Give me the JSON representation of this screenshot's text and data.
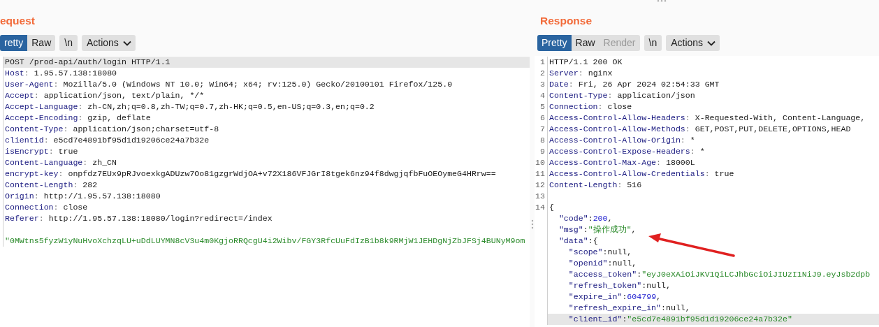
{
  "request": {
    "title": "equest",
    "tabs": [
      {
        "label": "retty",
        "selected": true,
        "disabled": false
      },
      {
        "label": "Raw",
        "selected": false,
        "disabled": false
      }
    ],
    "newline_button": "\\n",
    "actions_button": "Actions",
    "lines": [
      {
        "selected": true,
        "segments": [
          {
            "kind": "value",
            "text": "POST /prod-api/auth/login HTTP/1.1"
          }
        ]
      },
      {
        "selected": false,
        "segments": [
          {
            "kind": "name",
            "text": "Host"
          },
          {
            "kind": "sep",
            "text": ": "
          },
          {
            "kind": "value",
            "text": "1.95.57.138:18080"
          }
        ]
      },
      {
        "selected": false,
        "segments": [
          {
            "kind": "name",
            "text": "User-Agent"
          },
          {
            "kind": "sep",
            "text": ": "
          },
          {
            "kind": "value",
            "text": "Mozilla/5.0 (Windows NT 10.0; Win64; x64; rv:125.0) Gecko/20100101 Firefox/125.0"
          }
        ]
      },
      {
        "selected": false,
        "segments": [
          {
            "kind": "name",
            "text": "Accept"
          },
          {
            "kind": "sep",
            "text": ": "
          },
          {
            "kind": "value",
            "text": "application/json, text/plain, */*"
          }
        ]
      },
      {
        "selected": false,
        "segments": [
          {
            "kind": "name",
            "text": "Accept-Language"
          },
          {
            "kind": "sep",
            "text": ": "
          },
          {
            "kind": "value",
            "text": "zh-CN,zh;q=0.8,zh-TW;q=0.7,zh-HK;q=0.5,en-US;q=0.3,en;q=0.2"
          }
        ]
      },
      {
        "selected": false,
        "segments": [
          {
            "kind": "name",
            "text": "Accept-Encoding"
          },
          {
            "kind": "sep",
            "text": ": "
          },
          {
            "kind": "value",
            "text": "gzip, deflate"
          }
        ]
      },
      {
        "selected": false,
        "segments": [
          {
            "kind": "name",
            "text": "Content-Type"
          },
          {
            "kind": "sep",
            "text": ": "
          },
          {
            "kind": "value",
            "text": "application/json;charset=utf-8"
          }
        ]
      },
      {
        "selected": false,
        "segments": [
          {
            "kind": "name",
            "text": "clientid"
          },
          {
            "kind": "sep",
            "text": ": "
          },
          {
            "kind": "value",
            "text": "e5cd7e4891bf95d1d19206ce24a7b32e"
          }
        ]
      },
      {
        "selected": false,
        "segments": [
          {
            "kind": "name",
            "text": "isEncrypt"
          },
          {
            "kind": "sep",
            "text": ": "
          },
          {
            "kind": "value",
            "text": "true"
          }
        ]
      },
      {
        "selected": false,
        "segments": [
          {
            "kind": "name",
            "text": "Content-Language"
          },
          {
            "kind": "sep",
            "text": ": "
          },
          {
            "kind": "value",
            "text": "zh_CN"
          }
        ]
      },
      {
        "selected": false,
        "segments": [
          {
            "kind": "name",
            "text": "encrypt-key"
          },
          {
            "kind": "sep",
            "text": ": "
          },
          {
            "kind": "value",
            "text": "onpfdz7EUx9pRJvoexkgADUzw7Oo81gzgrWdjOA+v72X186VFJGrI8tgek6nz94f8dwgjqfbFuOEOymeG4HRrw=="
          }
        ]
      },
      {
        "selected": false,
        "segments": [
          {
            "kind": "name",
            "text": "Content-Length"
          },
          {
            "kind": "sep",
            "text": ": "
          },
          {
            "kind": "value",
            "text": "282"
          }
        ]
      },
      {
        "selected": false,
        "segments": [
          {
            "kind": "name",
            "text": "Origin"
          },
          {
            "kind": "sep",
            "text": ": "
          },
          {
            "kind": "value",
            "text": "http://1.95.57.138:18080"
          }
        ]
      },
      {
        "selected": false,
        "segments": [
          {
            "kind": "name",
            "text": "Connection"
          },
          {
            "kind": "sep",
            "text": ": "
          },
          {
            "kind": "value",
            "text": "close"
          }
        ]
      },
      {
        "selected": false,
        "segments": [
          {
            "kind": "name",
            "text": "Referer"
          },
          {
            "kind": "sep",
            "text": ": "
          },
          {
            "kind": "value",
            "text": "http://1.95.57.138:18080/login?redirect=/index"
          }
        ]
      },
      {
        "selected": false
      },
      {
        "selected": false,
        "segments": [
          {
            "kind": "string",
            "text": "\"0MWtns5fyzW1yNuHvoXchzqLU+uDdLUYMN8cV3u4m0KgjoRRQcgU4i2Wibv/FGY3RfcUuFdIzB1b8k9RMjW1JEHDgNjZbJFSj4BUNyM9om"
          }
        ]
      }
    ]
  },
  "response": {
    "title": "Response",
    "tabs": [
      {
        "label": "Pretty",
        "selected": true,
        "disabled": false
      },
      {
        "label": "Raw",
        "selected": false,
        "disabled": false
      },
      {
        "label": "Render",
        "selected": false,
        "disabled": true
      }
    ],
    "newline_button": "\\n",
    "actions_button": "Actions",
    "lines": [
      {
        "number": "1",
        "selected": false,
        "segments": [
          {
            "kind": "value",
            "text": "HTTP/1.1 200 OK"
          }
        ]
      },
      {
        "number": "2",
        "selected": false,
        "segments": [
          {
            "kind": "name",
            "text": "Server"
          },
          {
            "kind": "sep",
            "text": ": "
          },
          {
            "kind": "value",
            "text": "nginx"
          }
        ]
      },
      {
        "number": "3",
        "selected": false,
        "segments": [
          {
            "kind": "name",
            "text": "Date"
          },
          {
            "kind": "sep",
            "text": ": "
          },
          {
            "kind": "value",
            "text": "Fri, 26 Apr 2024 02:54:33 GMT"
          }
        ]
      },
      {
        "number": "4",
        "selected": false,
        "segments": [
          {
            "kind": "name",
            "text": "Content-Type"
          },
          {
            "kind": "sep",
            "text": ": "
          },
          {
            "kind": "value",
            "text": "application/json"
          }
        ]
      },
      {
        "number": "5",
        "selected": false,
        "segments": [
          {
            "kind": "name",
            "text": "Connection"
          },
          {
            "kind": "sep",
            "text": ": "
          },
          {
            "kind": "value",
            "text": "close"
          }
        ]
      },
      {
        "number": "6",
        "selected": false,
        "segments": [
          {
            "kind": "name",
            "text": "Access-Control-Allow-Headers"
          },
          {
            "kind": "sep",
            "text": ": "
          },
          {
            "kind": "value",
            "text": "X-Requested-With, Content-Language,"
          }
        ]
      },
      {
        "number": "7",
        "selected": false,
        "segments": [
          {
            "kind": "name",
            "text": "Access-Control-Allow-Methods"
          },
          {
            "kind": "sep",
            "text": ": "
          },
          {
            "kind": "value",
            "text": "GET,POST,PUT,DELETE,OPTIONS,HEAD"
          }
        ]
      },
      {
        "number": "8",
        "selected": false,
        "segments": [
          {
            "kind": "name",
            "text": "Access-Control-Allow-Origin"
          },
          {
            "kind": "sep",
            "text": ": "
          },
          {
            "kind": "value",
            "text": "*"
          }
        ]
      },
      {
        "number": "9",
        "selected": false,
        "segments": [
          {
            "kind": "name",
            "text": "Access-Control-Expose-Headers"
          },
          {
            "kind": "sep",
            "text": ": "
          },
          {
            "kind": "value",
            "text": "*"
          }
        ]
      },
      {
        "number": "10",
        "selected": false,
        "segments": [
          {
            "kind": "name",
            "text": "Access-Control-Max-Age"
          },
          {
            "kind": "sep",
            "text": ": "
          },
          {
            "kind": "value",
            "text": "18000L"
          }
        ]
      },
      {
        "number": "11",
        "selected": false,
        "segments": [
          {
            "kind": "name",
            "text": "Access-Control-Allow-Credentials"
          },
          {
            "kind": "sep",
            "text": ": "
          },
          {
            "kind": "value",
            "text": "true"
          }
        ]
      },
      {
        "number": "12",
        "selected": false,
        "segments": [
          {
            "kind": "name",
            "text": "Content-Length"
          },
          {
            "kind": "sep",
            "text": ": "
          },
          {
            "kind": "value",
            "text": "516"
          }
        ]
      },
      {
        "number": "13",
        "selected": false
      },
      {
        "number": "14",
        "selected": false,
        "segments": [
          {
            "kind": "punct",
            "text": "{"
          }
        ]
      },
      {
        "selected": false,
        "segments": [
          {
            "kind": "key",
            "text": "  \"code\""
          },
          {
            "kind": "punct",
            "text": ":"
          },
          {
            "kind": "number",
            "text": "200"
          },
          {
            "kind": "punct",
            "text": ","
          }
        ]
      },
      {
        "selected": false,
        "segments": [
          {
            "kind": "key",
            "text": "  \"msg\""
          },
          {
            "kind": "punct",
            "text": ":"
          },
          {
            "kind": "string",
            "text": "\"操作成功\""
          },
          {
            "kind": "punct",
            "text": ","
          }
        ]
      },
      {
        "selected": false,
        "segments": [
          {
            "kind": "key",
            "text": "  \"data\""
          },
          {
            "kind": "punct",
            "text": ":{"
          }
        ]
      },
      {
        "selected": false,
        "segments": [
          {
            "kind": "key",
            "text": "    \"scope\""
          },
          {
            "kind": "punct",
            "text": ":"
          },
          {
            "kind": "null",
            "text": "null"
          },
          {
            "kind": "punct",
            "text": ","
          }
        ]
      },
      {
        "selected": false,
        "segments": [
          {
            "kind": "key",
            "text": "    \"openid\""
          },
          {
            "kind": "punct",
            "text": ":"
          },
          {
            "kind": "null",
            "text": "null"
          },
          {
            "kind": "punct",
            "text": ","
          }
        ]
      },
      {
        "selected": false,
        "segments": [
          {
            "kind": "key",
            "text": "    \"access_token\""
          },
          {
            "kind": "punct",
            "text": ":"
          },
          {
            "kind": "string",
            "text": "\"eyJ0eXAiOiJKV1QiLCJhbGciOiJIUzI1NiJ9.eyJsb2dpb"
          }
        ]
      },
      {
        "selected": false,
        "segments": [
          {
            "kind": "key",
            "text": "    \"refresh_token\""
          },
          {
            "kind": "punct",
            "text": ":"
          },
          {
            "kind": "null",
            "text": "null"
          },
          {
            "kind": "punct",
            "text": ","
          }
        ]
      },
      {
        "selected": false,
        "segments": [
          {
            "kind": "key",
            "text": "    \"expire_in\""
          },
          {
            "kind": "punct",
            "text": ":"
          },
          {
            "kind": "number",
            "text": "604799"
          },
          {
            "kind": "punct",
            "text": ","
          }
        ]
      },
      {
        "selected": false,
        "segments": [
          {
            "kind": "key",
            "text": "    \"refresh_expire_in\""
          },
          {
            "kind": "punct",
            "text": ":"
          },
          {
            "kind": "null",
            "text": "null"
          },
          {
            "kind": "punct",
            "text": ","
          }
        ]
      },
      {
        "selected": true,
        "segments": [
          {
            "kind": "key",
            "text": "    \"client_id\""
          },
          {
            "kind": "punct",
            "text": ":"
          },
          {
            "kind": "string",
            "text": "\"e5cd7e4891bf95d1d19206ce24a7b32e\""
          }
        ]
      }
    ]
  }
}
